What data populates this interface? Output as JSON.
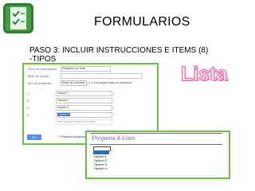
{
  "header": {
    "title": "FORMULARIOS",
    "heading_line1": "PASO 3: INCLUIR INSTRUCCIONES E ITEMS (8)",
    "heading_line2": "-TIPOS",
    "badge": "Lista"
  },
  "form": {
    "rows": [
      {
        "label": "Título de la pregunta",
        "value": "Pregunta con título"
      },
      {
        "label": "Texto de ayuda",
        "value": ""
      },
      {
        "label": "Tipo de pregunta",
        "value": "Elegir de una lista",
        "checkbox": "Ir a la página según la respuesta"
      }
    ],
    "options": [
      {
        "num": "1.",
        "value": "Opción 1"
      },
      {
        "num": "2.",
        "value": "Opción 2"
      },
      {
        "num": "3.",
        "value": "Opción 3"
      },
      {
        "num": "4.",
        "value": "Opción 4"
      }
    ],
    "add_option": "Haz clic para añadir una opción",
    "done_label": "OK",
    "required_label": "Pregunta obligatoria"
  },
  "preview": {
    "question": "Pregunta 4-Lista",
    "options": [
      "",
      "Opción 1",
      "Opción 2",
      "Opción 3",
      "Opción 4"
    ]
  },
  "colors": {
    "accent_green": "#6abf44",
    "badge_pink": "#f07ab1",
    "preview_purple": "#6e5ea8",
    "highlight_blue": "#3169c6"
  }
}
